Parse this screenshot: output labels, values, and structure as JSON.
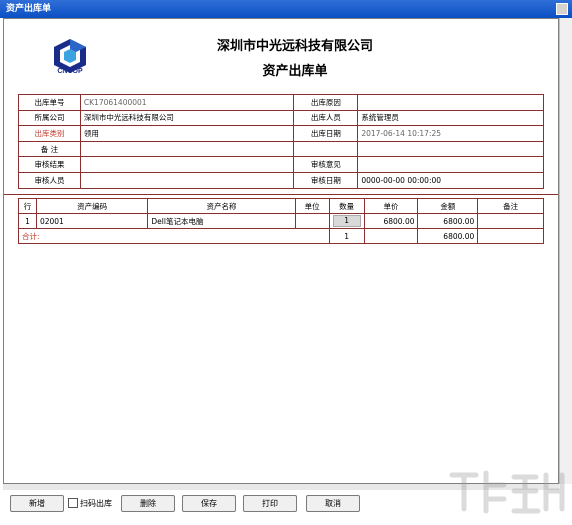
{
  "window": {
    "title": "资产出库单"
  },
  "header": {
    "logo_text": "CNCOP",
    "company": "深圳市中光远科技有限公司",
    "doc_title": "资产出库单"
  },
  "info": {
    "rows": [
      {
        "l1": "出库单号",
        "v1": "CK17061400001",
        "l2": "出库原因",
        "v2": ""
      },
      {
        "l1": "所属公司",
        "v1": "深圳市中光远科技有限公司",
        "l2": "出库人员",
        "v2": "系统管理员"
      },
      {
        "l1": "出库类别",
        "v1": "领用",
        "l2": "出库日期",
        "v2": "2017-06-14 10:17:25"
      },
      {
        "l1": "备 注",
        "v1": "",
        "l2": "",
        "v2": ""
      },
      {
        "l1": "审核结果",
        "v1": "",
        "l2": "审核意见",
        "v2": ""
      },
      {
        "l1": "审核人员",
        "v1": "",
        "l2": "审核日期",
        "v2": "0000-00-00 00:00:00"
      }
    ]
  },
  "items": {
    "headers": [
      "行",
      "资产编码",
      "资产名称",
      "单位",
      "数量",
      "单价",
      "金额",
      "备注"
    ],
    "rows": [
      {
        "row": "1",
        "code": "02001",
        "name": "Dell笔记本电脑",
        "unit": "",
        "qty": "1",
        "price": "6800.00",
        "amount": "6800.00",
        "note": ""
      }
    ],
    "total": {
      "label": "合计:",
      "qty": "1",
      "amount": "6800.00"
    }
  },
  "toolbar": {
    "add": "新增",
    "scan_out": "扫码出库",
    "delete": "删除",
    "save": "保存",
    "print": "打印",
    "cancel": "取消"
  }
}
